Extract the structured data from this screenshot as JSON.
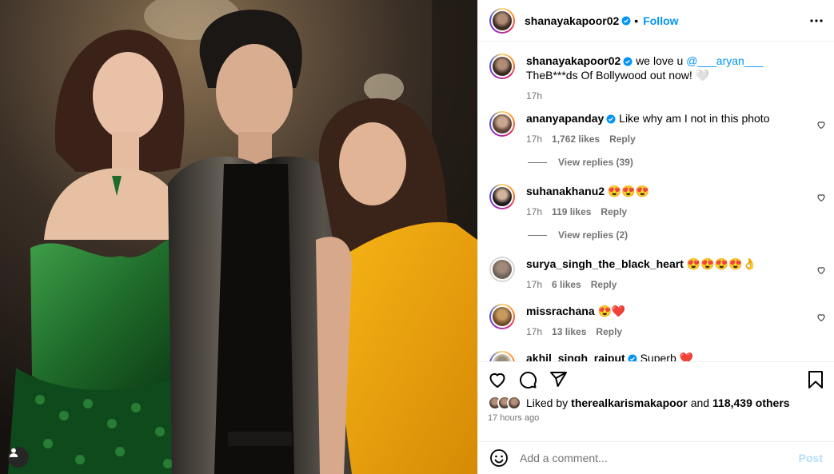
{
  "post": {
    "author": "shanayakapoor02",
    "follow_label": "Follow",
    "caption_text_prefix": "we love u",
    "caption_mention": "@___aryan___",
    "caption_text_suffix": "TheB***ds Of Bollywood out now! 🤍",
    "caption_time": "17h"
  },
  "comments": [
    {
      "user": "ananyapanday",
      "verified": true,
      "text": "Like why am I not in this photo",
      "time": "17h",
      "likes": "1,762 likes",
      "reply": "Reply",
      "view_replies": "View replies (39)"
    },
    {
      "user": "suhanakhanu2",
      "verified": false,
      "text": "😍😍😍",
      "time": "17h",
      "likes": "119 likes",
      "reply": "Reply",
      "view_replies": "View replies (2)"
    },
    {
      "user": "surya_singh_the_black_heart",
      "verified": false,
      "text": "😍😍😍😍👌",
      "time": "17h",
      "likes": "6 likes",
      "reply": "Reply"
    },
    {
      "user": "missrachana",
      "verified": false,
      "text": "😍❤️",
      "time": "17h",
      "likes": "13 likes",
      "reply": "Reply"
    },
    {
      "user": "akhil_singh_rajput",
      "verified": true,
      "text": "Superb ❤️"
    }
  ],
  "engagement": {
    "liked_by_prefix": "Liked by",
    "liked_by_user": "therealkarismakapoor",
    "liked_by_and": "and",
    "others": "118,439 others",
    "time_ago": "17 hours ago"
  },
  "add_comment": {
    "placeholder": "Add a comment...",
    "post_label": "Post"
  },
  "icons": [
    "more-icon",
    "heart-icon",
    "comment-icon",
    "share-icon",
    "save-icon",
    "emoji-icon",
    "tag-user-icon",
    "verified-badge-icon"
  ],
  "colors": {
    "link": "#0095f6",
    "verified": "#0095f6",
    "secondary": "#737373",
    "post_disabled": "#b2dffc"
  }
}
